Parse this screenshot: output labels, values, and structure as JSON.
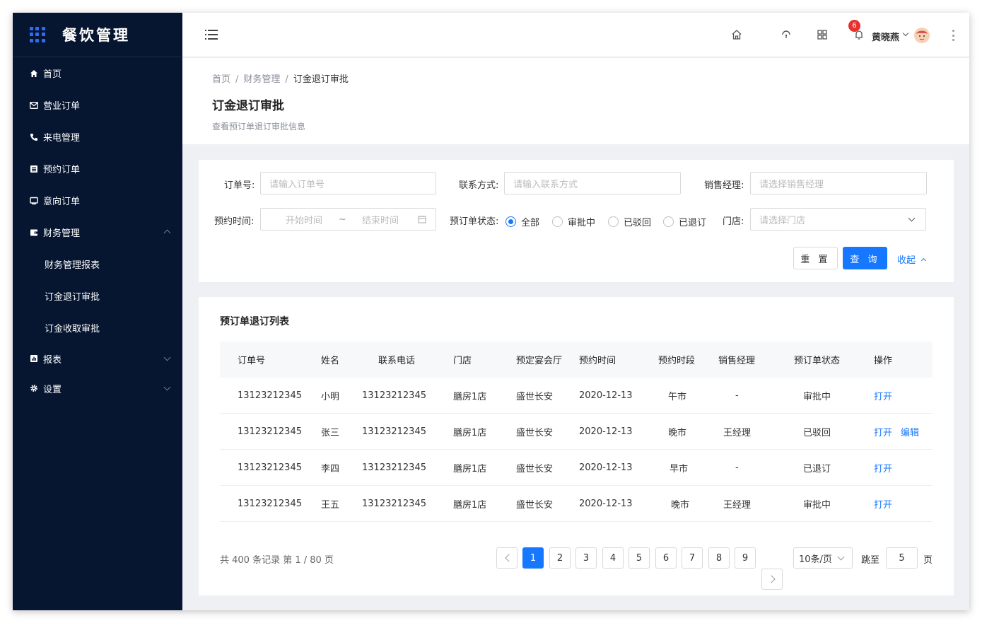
{
  "app": {
    "title": "餐饮管理"
  },
  "sidebar": {
    "items": [
      {
        "label": "首页"
      },
      {
        "label": "营业订单"
      },
      {
        "label": "来电管理"
      },
      {
        "label": "预约订单"
      },
      {
        "label": "意向订单"
      },
      {
        "label": "财务管理"
      },
      {
        "label": "财务管理报表"
      },
      {
        "label": "订金退订审批"
      },
      {
        "label": "订金收取审批"
      },
      {
        "label": "报表"
      },
      {
        "label": "设置"
      }
    ]
  },
  "header": {
    "notification_count": "6",
    "username": "黄晓燕"
  },
  "breadcrumb": [
    "首页",
    "财务管理",
    "订金退订审批"
  ],
  "page": {
    "title": "订金退订审批",
    "description": "查看预订单退订审批信息"
  },
  "filter": {
    "order_no_label": "订单号:",
    "order_no_placeholder": "请输入订单号",
    "contact_label": "联系方式:",
    "contact_placeholder": "请输入联系方式",
    "manager_label": "销售经理:",
    "manager_placeholder": "请选择销售经理",
    "time_label": "预约时间:",
    "start_placeholder": "开始时间",
    "range_sep": "~",
    "end_placeholder": "结束时间",
    "status_label": "预订单状态:",
    "status_options": [
      "全部",
      "审批中",
      "已驳回",
      "已退订"
    ],
    "status_selected": "全部",
    "store_label": "门店:",
    "store_placeholder": "请选择门店",
    "reset_label": "重 置",
    "search_label": "查 询",
    "collapse_label": "收起"
  },
  "table": {
    "title": "预订单退订列表",
    "columns": [
      "订单号",
      "姓名",
      "联系电话",
      "门店",
      "预定宴会厅",
      "预约时间",
      "预约时段",
      "销售经理",
      "预订单状态",
      "操作"
    ],
    "rows": [
      {
        "order_no": "13123212345",
        "name": "小明",
        "phone": "13123212345",
        "store": "膳房1店",
        "hall": "盛世长安",
        "date": "2020-12-13",
        "period": "午市",
        "manager": "-",
        "status": "审批中",
        "actions": [
          "打开"
        ]
      },
      {
        "order_no": "13123212345",
        "name": "张三",
        "phone": "13123212345",
        "store": "膳房1店",
        "hall": "盛世长安",
        "date": "2020-12-13",
        "period": "晚市",
        "manager": "王经理",
        "status": "已驳回",
        "actions": [
          "打开",
          "编辑"
        ]
      },
      {
        "order_no": "13123212345",
        "name": "李四",
        "phone": "13123212345",
        "store": "膳房1店",
        "hall": "盛世长安",
        "date": "2020-12-13",
        "period": "早市",
        "manager": "-",
        "status": "已退订",
        "actions": [
          "打开"
        ]
      },
      {
        "order_no": "13123212345",
        "name": "王五",
        "phone": "13123212345",
        "store": "膳房1店",
        "hall": "盛世长安",
        "date": "2020-12-13",
        "period": "晚市",
        "manager": "王经理",
        "status": "审批中",
        "actions": [
          "打开"
        ]
      }
    ]
  },
  "pagination": {
    "total_text": "共 400 条记录 第 1 / 80 页",
    "pages": [
      "1",
      "2",
      "3",
      "4",
      "5",
      "6",
      "7",
      "8",
      "9"
    ],
    "current_page": "1",
    "page_size": "10条/页",
    "jump_label": "跳至",
    "jump_value": "5",
    "page_suffix": "页"
  },
  "colors": {
    "sidebar_bg": "#061530",
    "accent": "#1677ff",
    "badge": "#e8302f"
  }
}
